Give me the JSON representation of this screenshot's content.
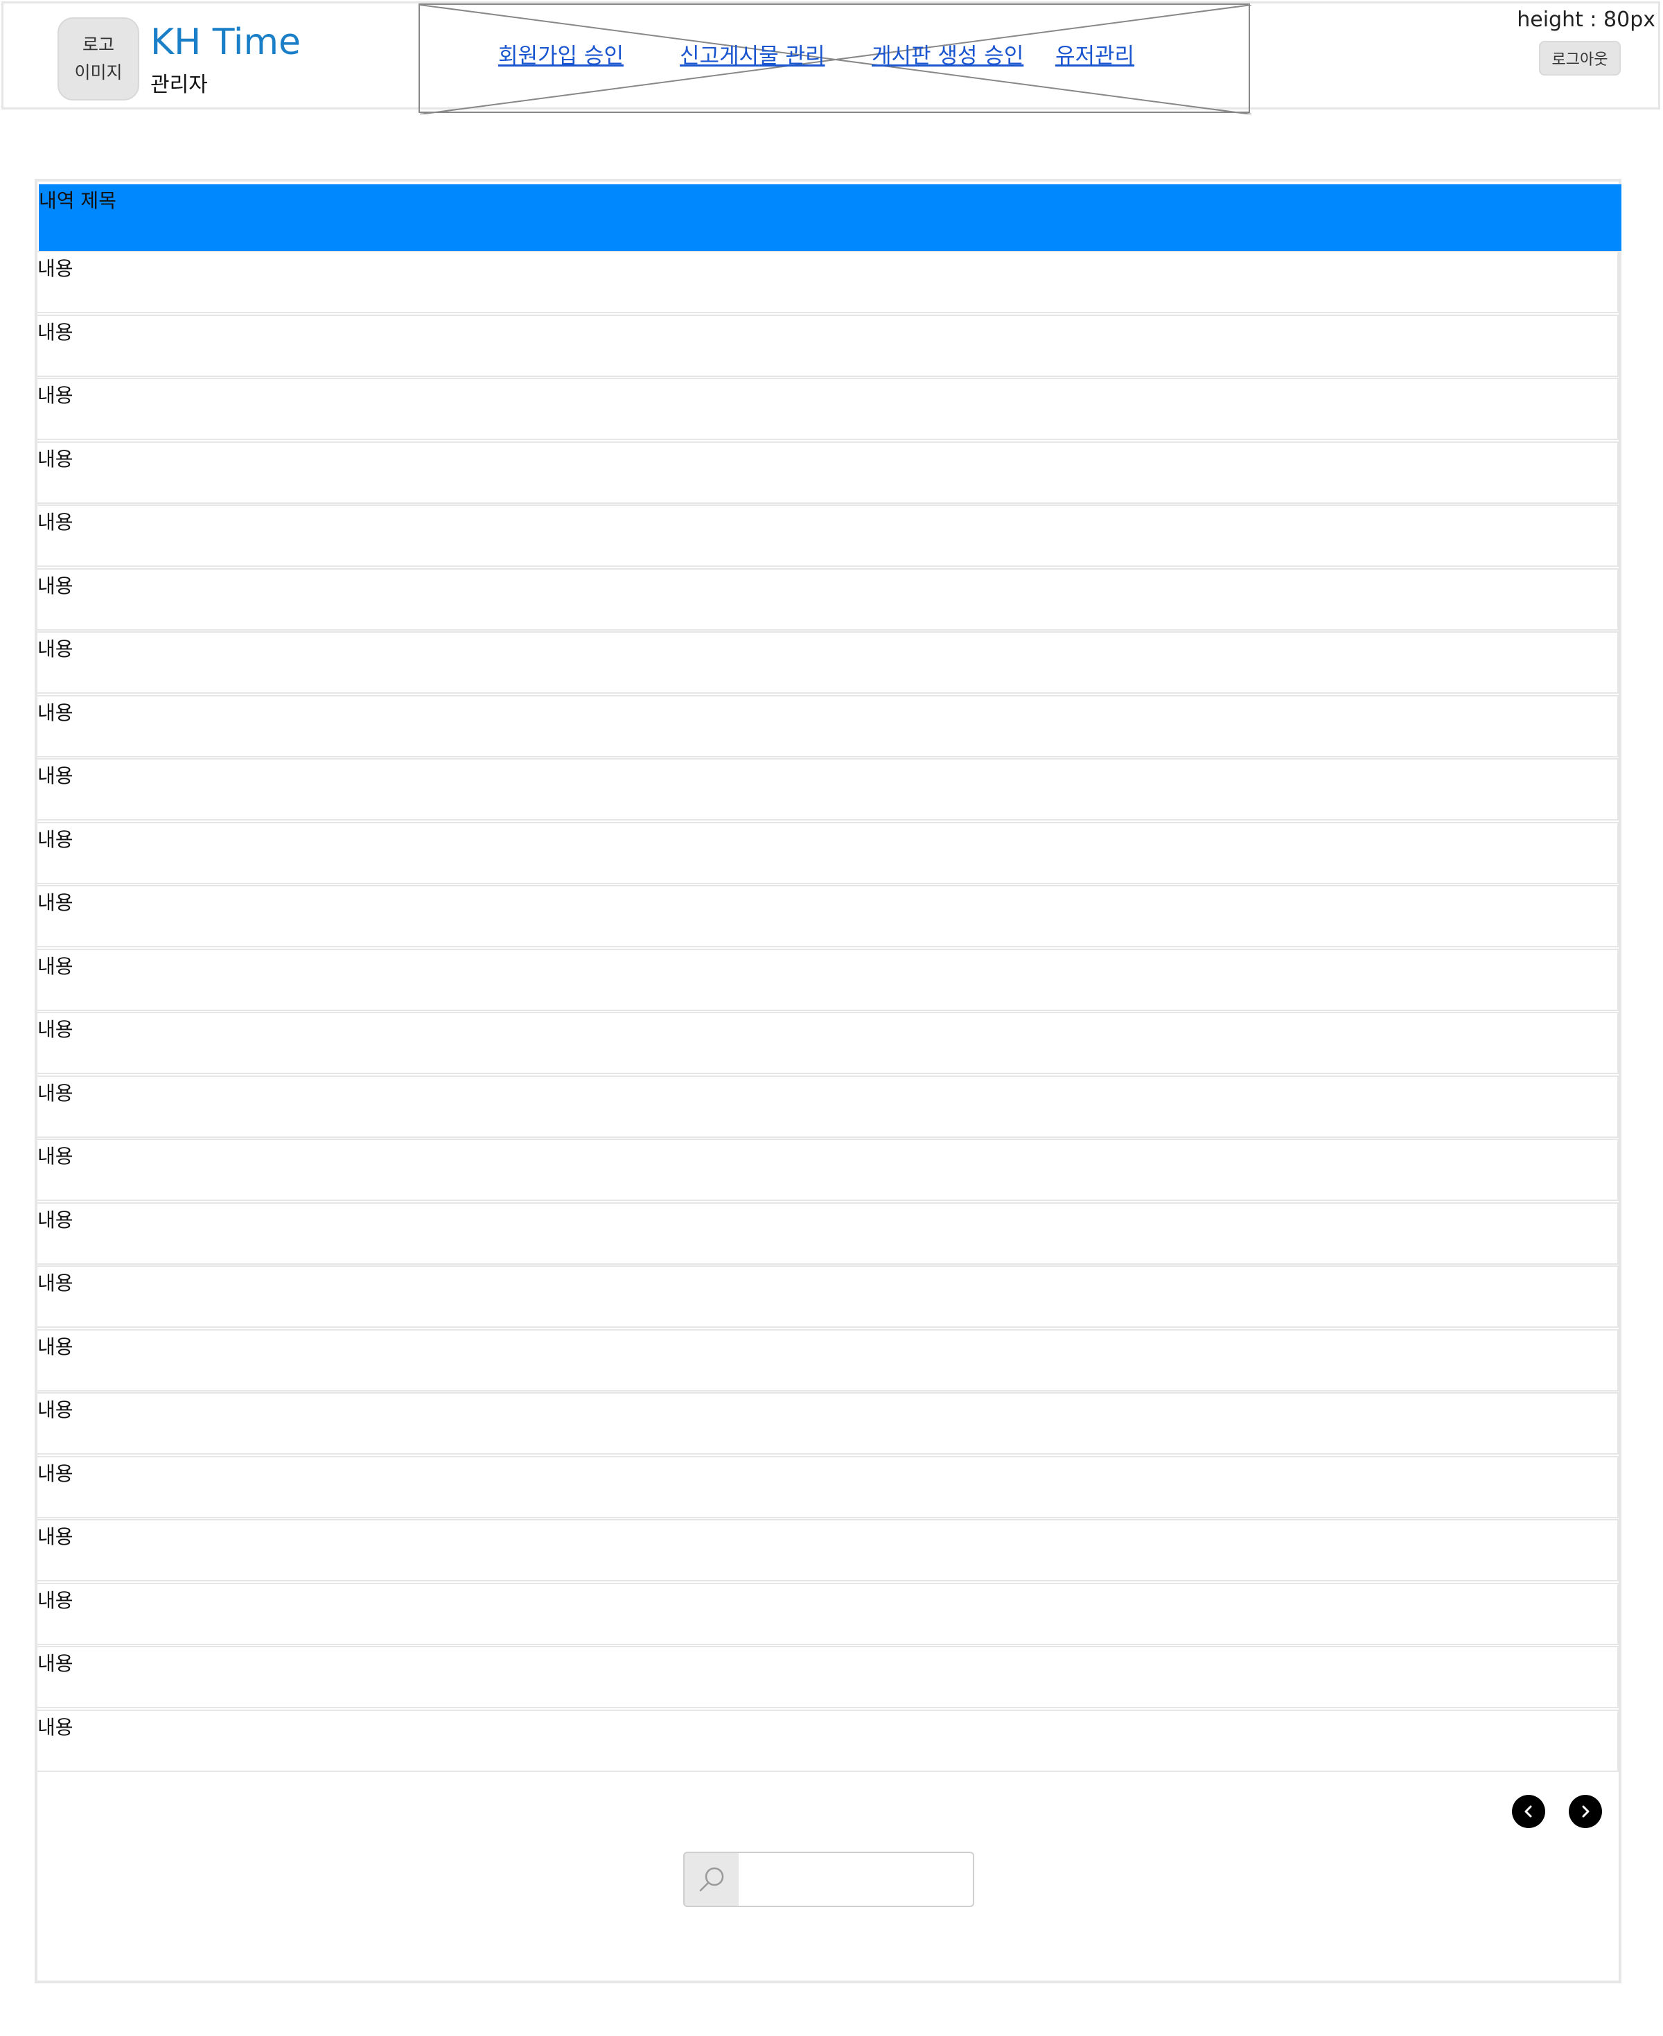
{
  "header": {
    "logo_line1": "로고",
    "logo_line2": "이미지",
    "brand": "KH Time",
    "role": "관리자",
    "nav": [
      {
        "label": "회원가입 승인"
      },
      {
        "label": "신고게시물 관리"
      },
      {
        "label": "게시판 생성 승인"
      },
      {
        "label": "유저관리"
      }
    ],
    "height_note": "height : 80px",
    "logout_label": "로그아웃"
  },
  "list": {
    "title": "내역 제목",
    "rows": [
      "내용",
      "내용",
      "내용",
      "내용",
      "내용",
      "내용",
      "내용",
      "내용",
      "내용",
      "내용",
      "내용",
      "내용",
      "내용",
      "내용",
      "내용",
      "내용",
      "내용",
      "내용",
      "내용",
      "내용",
      "내용",
      "내용",
      "내용",
      "내용"
    ]
  },
  "pager": {
    "prev_icon": "chevron-left-icon",
    "next_icon": "chevron-right-icon"
  },
  "search": {
    "icon": "search-icon",
    "value": "",
    "placeholder": ""
  }
}
